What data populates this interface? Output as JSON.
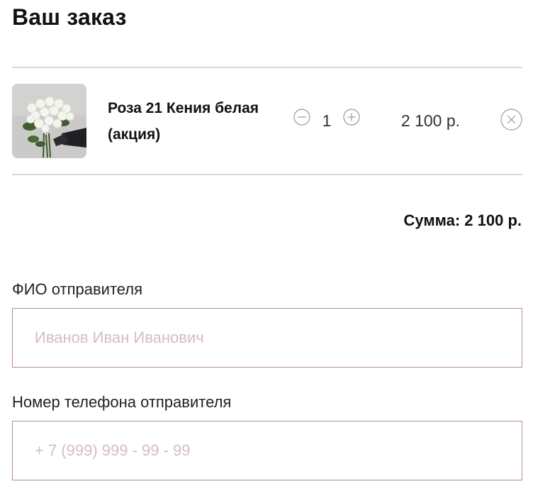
{
  "title": "Ваш заказ",
  "cart": {
    "items": [
      {
        "name": "Роза 21 Кения белая (акция)",
        "quantity": "1",
        "price": "2 100 р.",
        "image_icon": "white-roses-bouquet-image"
      }
    ],
    "sum_text": "Сумма: 2 100 р."
  },
  "form": {
    "sender_name_label": "ФИО отправителя",
    "sender_name_placeholder": "Иванов Иван Иванович",
    "sender_phone_label": "Номер телефона отправителя",
    "sender_phone_placeholder": "+ 7 (999) 999 - 99 - 99"
  },
  "colors": {
    "divider": "#d9d9d9",
    "input_border": "#b58a99",
    "placeholder": "#d4bdc5",
    "icon_stroke": "#9a9a9a"
  }
}
